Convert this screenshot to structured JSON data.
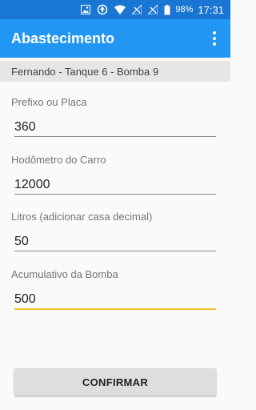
{
  "status_bar": {
    "icons": [
      "image-icon",
      "sync-icon",
      "wifi-icon",
      "signal-off-icon",
      "signal-off-icon",
      "battery-icon"
    ],
    "battery": "98%",
    "time": "17:31"
  },
  "app_bar": {
    "title": "Abastecimento",
    "menu_icon": "more-vert-icon"
  },
  "subheader": "Fernando - Tanque 6 - Bomba 9",
  "fields": [
    {
      "label": "Prefixo ou Placa",
      "value": "360"
    },
    {
      "label": "Hodômetro do Carro",
      "value": "12000"
    },
    {
      "label": "Litros (adicionar casa decimal)",
      "value": "50"
    },
    {
      "label": "Acumulativo da Bomba",
      "value": "500"
    }
  ],
  "confirm_label": "CONFIRMAR",
  "colors": {
    "status_bar": "#1976d2",
    "app_bar": "#2196f3",
    "focus_underline": "#fbc02d"
  }
}
